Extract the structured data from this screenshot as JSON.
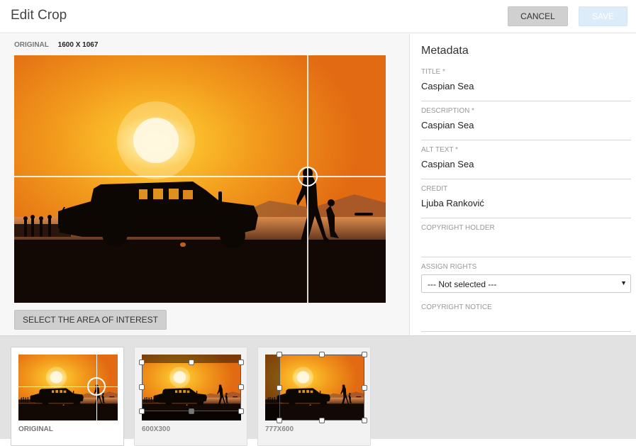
{
  "header": {
    "title": "Edit Crop",
    "cancel_label": "CANCEL",
    "save_label": "SAVE"
  },
  "editor": {
    "original_label": "ORIGINAL",
    "original_dims": "1600 X 1067",
    "select_area_label": "SELECT THE AREA OF INTEREST"
  },
  "metadata": {
    "title": "Metadata",
    "fields": [
      {
        "label": "TITLE *",
        "value": "Caspian Sea"
      },
      {
        "label": "DESCRIPTION *",
        "value": "Caspian Sea"
      },
      {
        "label": "ALT TEXT *",
        "value": "Caspian Sea"
      },
      {
        "label": "CREDIT",
        "value": "Ljuba Ranković"
      },
      {
        "label": "COPYRIGHT HOLDER",
        "value": ""
      }
    ],
    "assign_rights": {
      "label": "ASSIGN RIGHTS",
      "selected": "--- Not selected ---"
    },
    "copyright_notice": {
      "label": "COPYRIGHT NOTICE",
      "value": ""
    }
  },
  "thumbnails": [
    {
      "label": "ORIGINAL",
      "active": true
    },
    {
      "label": "600X300",
      "active": false
    },
    {
      "label": "777X600",
      "active": false
    }
  ],
  "colors": {
    "sky_top": "#ef8a1e",
    "sky_mid": "#f4b01c",
    "sun": "#fff7d6",
    "ground": "#140a05",
    "save_disabled": "#dcecf8"
  }
}
